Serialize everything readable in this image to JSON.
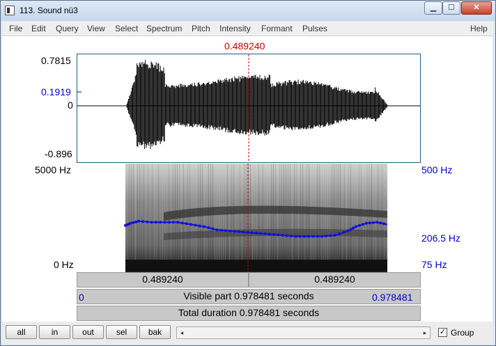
{
  "window": {
    "title": "113. Sound nü3",
    "minimize_glyph": "▁",
    "maximize_glyph": "☐",
    "close_glyph": "✕"
  },
  "menu": [
    "File",
    "Edit",
    "Query",
    "View",
    "Select",
    "Spectrum",
    "Pitch",
    "Intensity",
    "Formant",
    "Pulses",
    "Help"
  ],
  "cursor": {
    "time": "0.489240"
  },
  "waveform": {
    "ymax": "0.7815",
    "cursor_value": "0.1919",
    "zero": "0",
    "ymin": "-0.896"
  },
  "spectrogram": {
    "fmax": "5000 Hz",
    "fmin": "0 Hz",
    "pitch_max": "500 Hz",
    "pitch_value": "206.5 Hz",
    "pitch_min": "75 Hz"
  },
  "pitch_track": [
    [
      0.0,
      0.43
    ],
    [
      0.02,
      0.45
    ],
    [
      0.05,
      0.47
    ],
    [
      0.1,
      0.46
    ],
    [
      0.15,
      0.46
    ],
    [
      0.2,
      0.46
    ],
    [
      0.25,
      0.44
    ],
    [
      0.3,
      0.42
    ],
    [
      0.35,
      0.39
    ],
    [
      0.4,
      0.38
    ],
    [
      0.45,
      0.37
    ],
    [
      0.5,
      0.36
    ],
    [
      0.55,
      0.35
    ],
    [
      0.6,
      0.34
    ],
    [
      0.65,
      0.33
    ],
    [
      0.7,
      0.33
    ],
    [
      0.75,
      0.33
    ],
    [
      0.8,
      0.34
    ],
    [
      0.85,
      0.38
    ],
    [
      0.88,
      0.42
    ],
    [
      0.92,
      0.45
    ],
    [
      0.96,
      0.46
    ],
    [
      1.0,
      0.44
    ]
  ],
  "bars": {
    "left_time": "0.489240",
    "right_time": "0.489240",
    "visible_start": "0",
    "visible_text": "Visible part 0.978481 seconds",
    "visible_end": "0.978481",
    "total_text": "Total duration 0.978481 seconds"
  },
  "buttons": [
    "all",
    "in",
    "out",
    "sel",
    "bak"
  ],
  "group": {
    "label": "Group",
    "checked": "✓"
  },
  "scroll": {
    "left": "◂",
    "right": "▸"
  }
}
